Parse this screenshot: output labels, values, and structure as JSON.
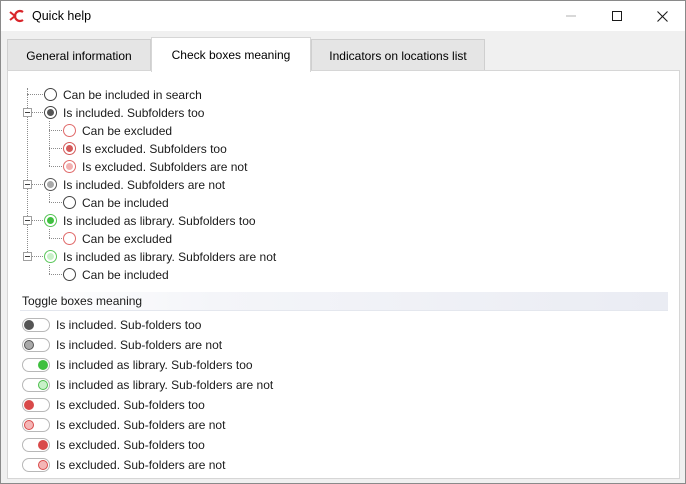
{
  "window": {
    "title": "Quick help"
  },
  "tabs": [
    {
      "label": "General information",
      "active": false
    },
    {
      "label": "Check boxes meaning",
      "active": true
    },
    {
      "label": "Indicators on locations list",
      "active": false
    }
  ],
  "tree_items": [
    {
      "label": "Can be included in search",
      "border": "#444444",
      "fill": ""
    },
    {
      "label": "Is included. Subfolders too",
      "border": "#444444",
      "fill": "#555555"
    },
    {
      "label": "Can be excluded",
      "border": "#e06a6a",
      "fill": ""
    },
    {
      "label": "Is excluded. Subfolders too",
      "border": "#d45a5a",
      "fill": "#d45a5a"
    },
    {
      "label": "Is excluded. Subfolders are not",
      "border": "#e06a6a",
      "fill": "#f2b0b0"
    },
    {
      "label": "Is included. Subfolders are not",
      "border": "#555555",
      "fill": "#a9a9a9"
    },
    {
      "label": "Can be included",
      "border": "#444444",
      "fill": ""
    },
    {
      "label": "Is included as library. Subfolders too",
      "border": "#55c455",
      "fill": "#3fbf3f"
    },
    {
      "label": "Can be excluded",
      "border": "#e06a6a",
      "fill": ""
    },
    {
      "label": "Is included as library. Subfolders are not",
      "border": "#5cc85c",
      "fill": "#c8f0c8"
    },
    {
      "label": "Can be included",
      "border": "#444444",
      "fill": ""
    }
  ],
  "toggle_section": {
    "title": "Toggle boxes meaning"
  },
  "toggles": [
    {
      "label": "Is included. Sub-folders too",
      "side": "left",
      "knob": "#555555",
      "ring": "#555555"
    },
    {
      "label": "Is included. Sub-folders are not",
      "side": "left",
      "knob": "#a9a9a9",
      "ring": "#555555"
    },
    {
      "label": "Is included as library. Sub-folders too",
      "side": "right",
      "knob": "#3fbf3f",
      "ring": "#3fbf3f"
    },
    {
      "label": "Is included as library. Sub-folders are not",
      "side": "right",
      "knob": "#c8f0c8",
      "ring": "#4cbf4c"
    },
    {
      "label": "Is excluded. Sub-folders too",
      "side": "left",
      "knob": "#d94a4a",
      "ring": "#d94a4a"
    },
    {
      "label": "Is excluded. Sub-folders are not",
      "side": "left",
      "knob": "#f4b6b6",
      "ring": "#d94a4a"
    },
    {
      "label": "Is excluded. Sub-folders too",
      "side": "right",
      "knob": "#d94a4a",
      "ring": "#d94a4a"
    },
    {
      "label": "Is excluded. Sub-folders are not",
      "side": "right",
      "knob": "#f4b6b6",
      "ring": "#d94a4a"
    }
  ]
}
